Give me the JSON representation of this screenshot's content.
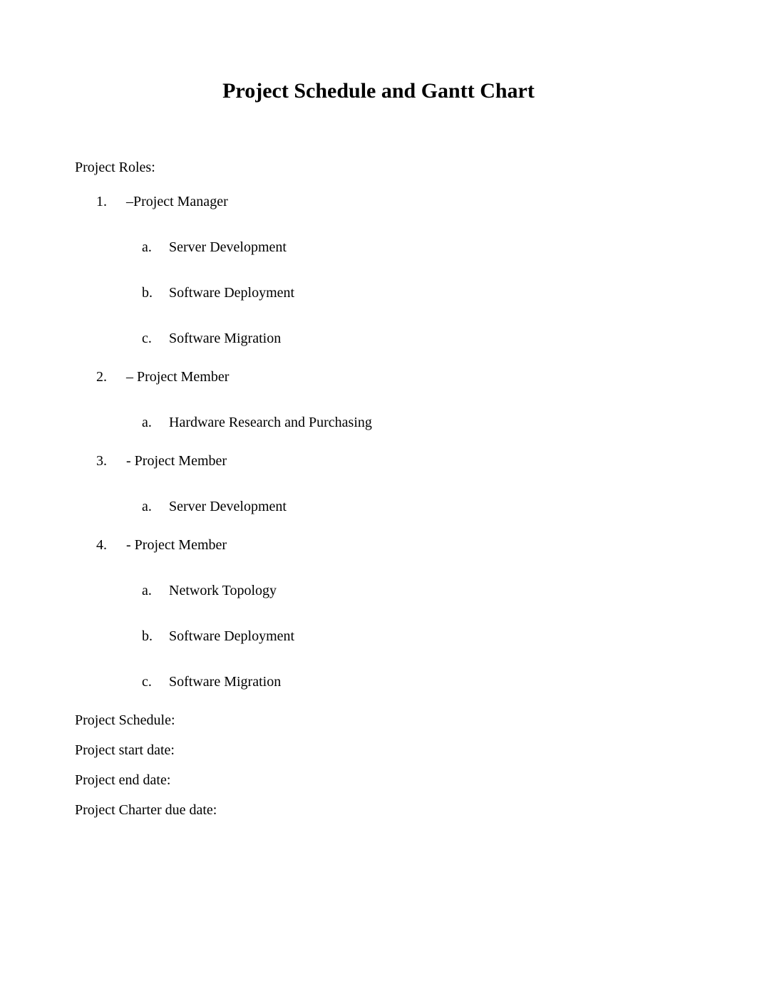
{
  "title": "Project Schedule and Gantt Chart",
  "rolesHeading": "Project Roles:",
  "roles": [
    {
      "label": "–Project Manager",
      "tasks": [
        "Server Development",
        "Software Deployment",
        "Software Migration"
      ]
    },
    {
      "label": "– Project Member",
      "tasks": [
        "Hardware Research and Purchasing"
      ]
    },
    {
      "label": "- Project Member",
      "tasks": [
        "Server Development"
      ]
    },
    {
      "label": "- Project Member",
      "tasks": [
        "Network Topology",
        "Software Deployment",
        "Software Migration"
      ]
    }
  ],
  "scheduleHeading": "Project Schedule:",
  "scheduleLines": [
    "Project start date:",
    "Project end date:",
    "Project Charter due date:"
  ]
}
